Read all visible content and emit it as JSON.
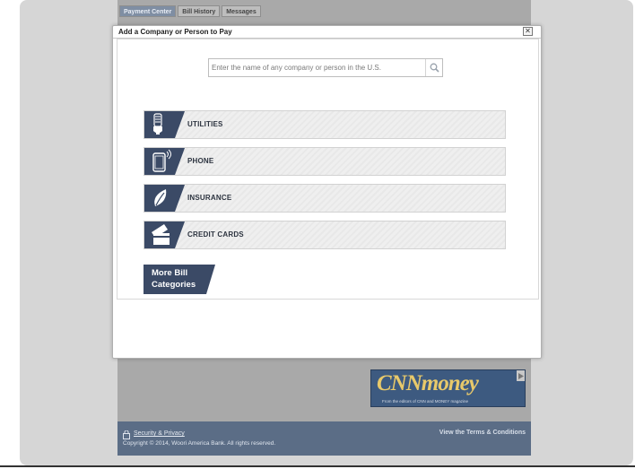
{
  "tabs": [
    {
      "label": "Payment Center"
    },
    {
      "label": "Bill History"
    },
    {
      "label": "Messages"
    }
  ],
  "dialog": {
    "title": "Add a Company or Person to Pay",
    "close_label": "✕"
  },
  "search": {
    "placeholder": "Enter the name of any company or person in the U.S."
  },
  "categories": [
    {
      "label": "UTILITIES",
      "icon": "lightbulb-icon"
    },
    {
      "label": "PHONE",
      "icon": "phone-icon"
    },
    {
      "label": "INSURANCE",
      "icon": "leaf-icon"
    },
    {
      "label": "CREDIT CARDS",
      "icon": "credit-card-icon"
    }
  ],
  "more": {
    "line1": "More Bill",
    "line2": "Categories"
  },
  "ad": {
    "brand": "CNNmoney",
    "tagline": "From the editors of CNN and MONEY magazine"
  },
  "footer": {
    "security_link": "Security & Privacy",
    "copyright": "Copyright © 2014, Woori America Bank. All rights reserved.",
    "terms_link": "View the Terms & Conditions"
  },
  "colors": {
    "category_icon_bg": "#3b4a66",
    "footer_bg": "#5b6d86",
    "ad_bg": "#3d5a80"
  }
}
